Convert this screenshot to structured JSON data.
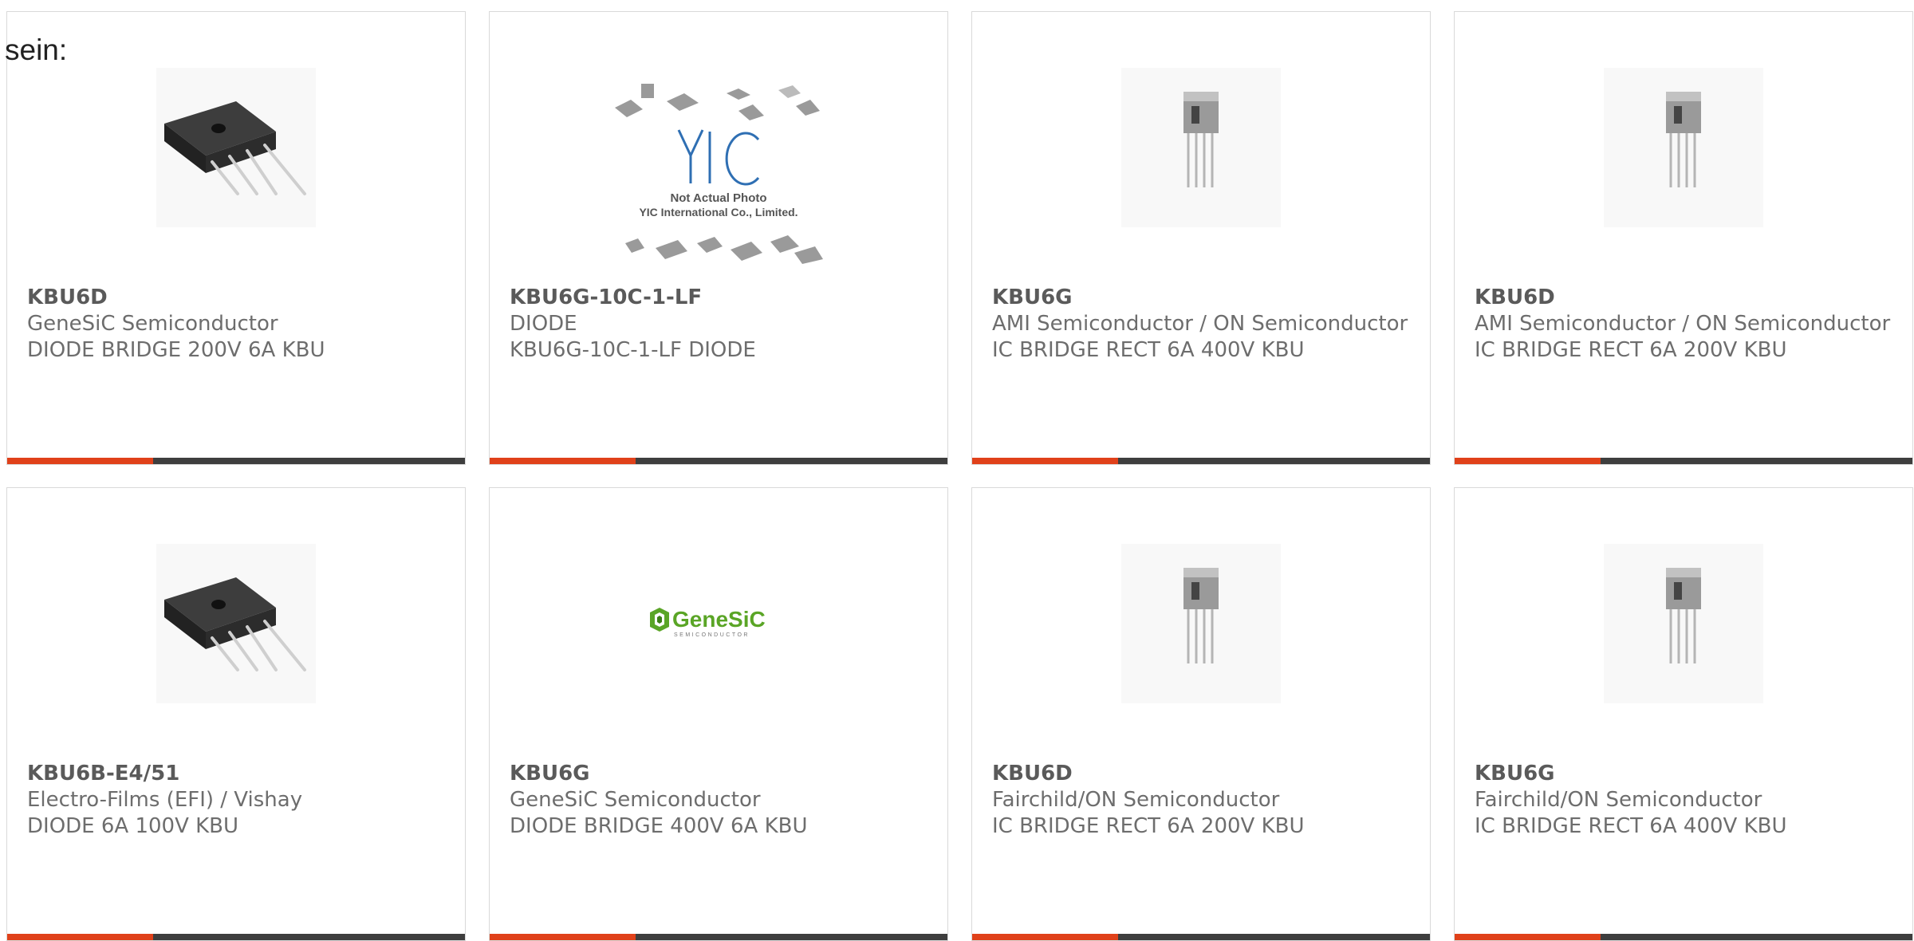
{
  "intro_text": "sein:",
  "colors": {
    "accent": "#e0411a",
    "bar": "#3e3e3e",
    "text": "#6d6d6d",
    "border": "#d9d9d9"
  },
  "products": [
    {
      "part": "KBU6D",
      "maker": "GeneSiC Semiconductor",
      "desc": "DIODE BRIDGE 200V 6A KBU",
      "image": "bridge-rectifier-black"
    },
    {
      "part": "KBU6G-10C-1-LF",
      "maker": "DIODE",
      "desc": "KBU6G-10C-1-LF DIODE",
      "image": "yic-placeholder",
      "placeholder": {
        "logo": "YIC",
        "line1": "Not Actual Photo",
        "line2": "YIC International Co., Limited."
      }
    },
    {
      "part": "KBU6G",
      "maker": "AMI Semiconductor / ON Semiconductor",
      "desc": "IC BRIDGE RECT 6A 400V KBU",
      "image": "bridge-rectifier-silver"
    },
    {
      "part": "KBU6D",
      "maker": "AMI Semiconductor / ON Semiconductor",
      "desc": "IC BRIDGE RECT 6A 200V KBU",
      "image": "bridge-rectifier-silver"
    },
    {
      "part": "KBU6B-E4/51",
      "maker": "Electro-Films (EFI) / Vishay",
      "desc": "DIODE 6A 100V KBU",
      "image": "bridge-rectifier-black"
    },
    {
      "part": "KBU6G",
      "maker": "GeneSiC Semiconductor",
      "desc": "DIODE BRIDGE 400V 6A KBU",
      "image": "genesic-logo",
      "logo": {
        "name": "GeneSiC",
        "sub": "SEMICONDUCTOR"
      }
    },
    {
      "part": "KBU6D",
      "maker": "Fairchild/ON Semiconductor",
      "desc": "IC BRIDGE RECT 6A 200V KBU",
      "image": "bridge-rectifier-silver"
    },
    {
      "part": "KBU6G",
      "maker": "Fairchild/ON Semiconductor",
      "desc": "IC BRIDGE RECT 6A 400V KBU",
      "image": "bridge-rectifier-silver"
    }
  ]
}
